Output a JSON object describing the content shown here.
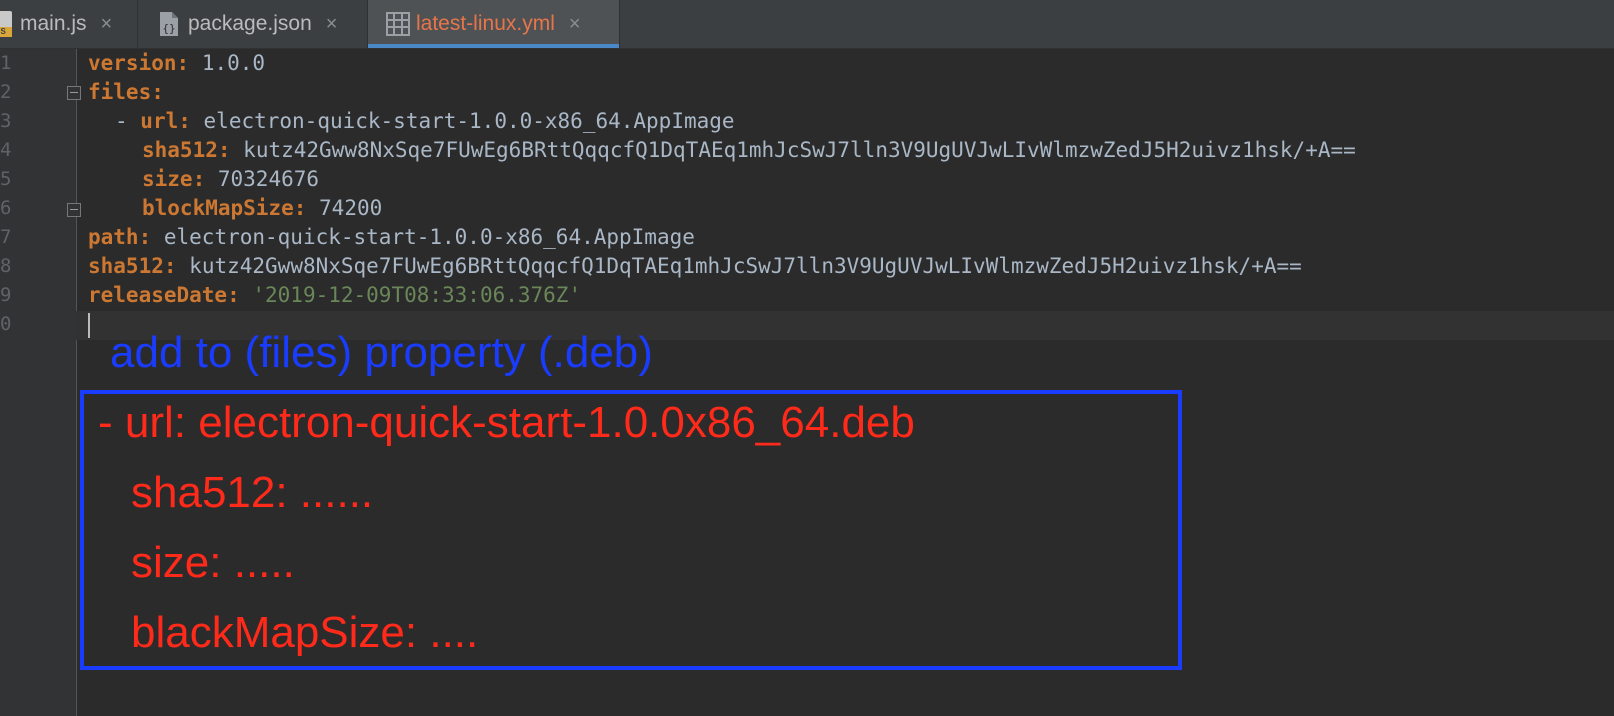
{
  "tabs": [
    {
      "label": "main.js",
      "icon": "js-file-icon",
      "active": false
    },
    {
      "label": "package.json",
      "icon": "json-file-icon",
      "active": false
    },
    {
      "label": "latest-linux.yml",
      "icon": "yaml-file-icon",
      "active": true
    }
  ],
  "close_glyph": "×",
  "gutter": {
    "line_numbers": [
      "1",
      "2",
      "3",
      "4",
      "5",
      "6",
      "7",
      "8",
      "9",
      "0"
    ]
  },
  "code": {
    "version_key": "version:",
    "version_val": "1.0.0",
    "files_key": "files:",
    "dash": "- ",
    "url_key": "url:",
    "url_val": "electron-quick-start-1.0.0-x86_64.AppImage",
    "sha_key": "sha512:",
    "sha_val": "kutz42Gww8NxSqe7FUwEg6BRttQqqcfQ1DqTAEq1mhJcSwJ7lln3V9UgUVJwLIvWlmzwZedJ5H2uivz1hsk/+A==",
    "size_key": "size:",
    "size_val": "70324676",
    "blockmap_key": "blockMapSize:",
    "blockmap_val": "74200",
    "path_key": "path:",
    "path_val": "electron-quick-start-1.0.0-x86_64.AppImage",
    "sha2_key": "sha512:",
    "sha2_val": "kutz42Gww8NxSqe7FUwEg6BRttQqqcfQ1DqTAEq1mhJcSwJ7lln3V9UgUVJwLIvWlmzwZedJ5H2uivz1hsk/+A==",
    "release_key": "releaseDate:",
    "release_val": "'2019-12-09T08:33:06.376Z'"
  },
  "annotation": {
    "heading": "add to (files) property (.deb)",
    "lines": [
      "- url: electron-quick-start-1.0.0x86_64.deb",
      "sha512: ......",
      "size: .....",
      "blackMapSize: ...."
    ]
  },
  "colors": {
    "background": "#2b2b2b",
    "yaml_key": "#cc7832",
    "yaml_value": "#a9b7c6",
    "yaml_string": "#6a8759",
    "annotation_blue": "#1a3cff",
    "annotation_red": "#ff2a1a",
    "active_tab_text": "#e8754a",
    "active_tab_underline": "#4a88c7"
  }
}
